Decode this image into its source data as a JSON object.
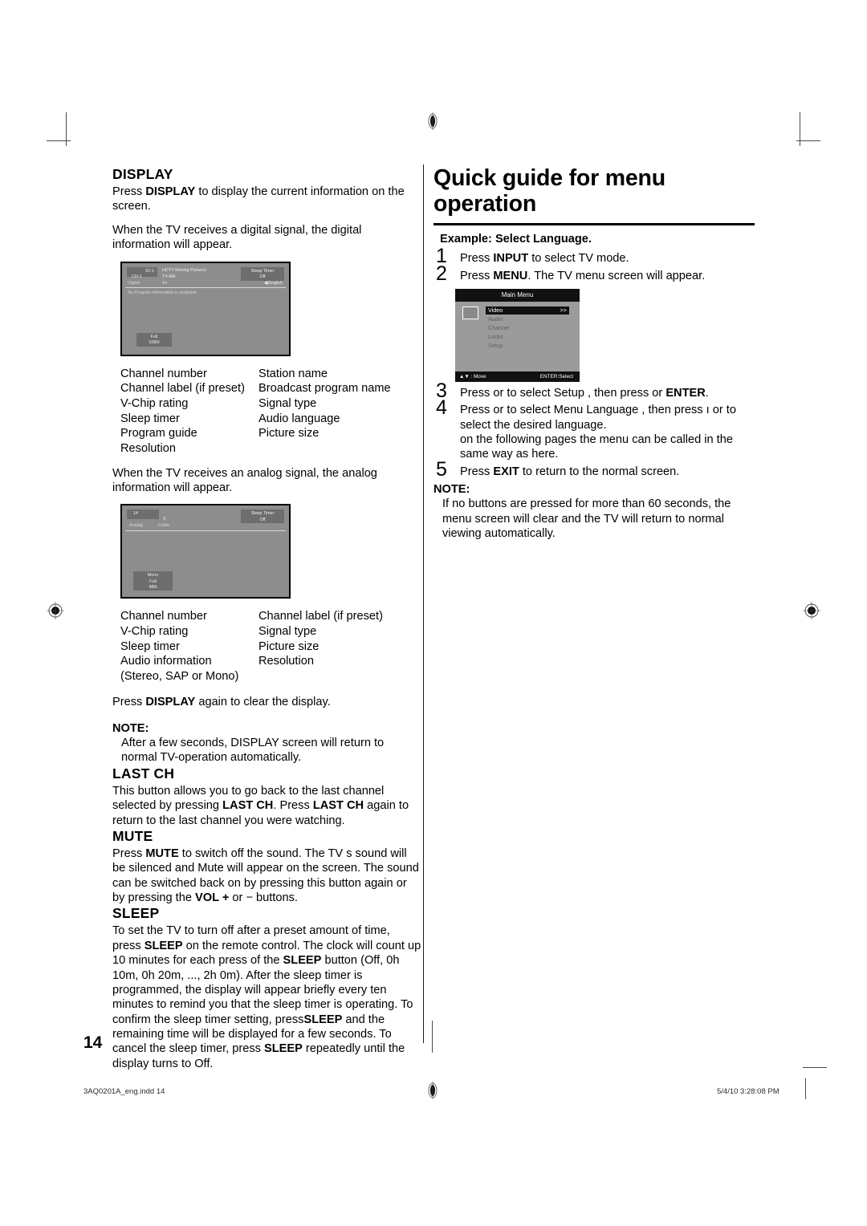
{
  "document": {
    "page_number": "14",
    "footer_filename": "3AQ0201A_eng.indd   14",
    "footer_timestamp": "5/4/10   3:28:08 PM"
  },
  "left_column": {
    "display": {
      "heading": "DISPLAY",
      "para1_a": "Press ",
      "para1_b": "DISPLAY",
      "para1_c": " to display the current information on the screen.",
      "para2": "When the TV receives a digital signal, the digital information will appear.",
      "para3": "When the TV receives an analog signal, the analog information will appear.",
      "digital_screen": {
        "channel_number": "62-1",
        "station_name": "HDTV Moving Picture1",
        "channel_label": "CH-1",
        "rating": "TV-MA",
        "signal_type": "Digital",
        "source": "Air",
        "sleep_timer_title": "Sleep Timer",
        "sleep_timer_value": "Off",
        "audio_language": "English",
        "program_info": "No Program Information is available",
        "picture_size": "Full",
        "resolution": "1080i"
      },
      "digital_legend": [
        [
          "Channel number",
          "Station name"
        ],
        [
          "Channel label (if preset)",
          "Broadcast program name"
        ],
        [
          "V-Chip rating",
          "Signal type"
        ],
        [
          "Sleep timer",
          "Audio language"
        ],
        [
          "Program guide",
          "Picture size"
        ],
        [
          "Resolution",
          ""
        ]
      ],
      "analog_screen": {
        "channel_number": "14",
        "channel_label": "X",
        "signal_type": "Analog",
        "source": "Cable",
        "sleep_timer_title": "Sleep Timer",
        "sleep_timer_value": "Off",
        "audio_information": "Mono",
        "picture_size": "Full",
        "resolution": "480i"
      },
      "analog_legend": [
        [
          "Channel number",
          "Channel label (if preset)"
        ],
        [
          "V-Chip rating",
          "Signal type"
        ],
        [
          "Sleep timer",
          "Picture size"
        ],
        [
          "Audio information",
          "Resolution"
        ],
        [
          "(Stereo, SAP or Mono)",
          ""
        ]
      ],
      "clear_a": "Press ",
      "clear_b": "DISPLAY",
      "clear_c": " again to clear the display.",
      "note_label": "NOTE:",
      "note_text": "After a few seconds, DISPLAY screen will return to normal TV-operation automatically."
    },
    "last_ch": {
      "heading": "LAST CH",
      "text_a": "This button allows you to go back to the last channel selected by pressing ",
      "text_b": "LAST CH",
      "text_c": ". Press ",
      "text_d": "LAST CH",
      "text_e": " again to return to the last channel you were watching."
    },
    "mute": {
      "heading": "MUTE",
      "text_a": "Press ",
      "text_b": "MUTE",
      "text_c": " to switch off the sound. The TV s sound will be silenced and  Mute  will appear on the screen. The sound can be switched back on by pressing this button again or by pressing the ",
      "text_d": "VOL +",
      "text_e": " or − buttons."
    },
    "sleep": {
      "heading": "SLEEP",
      "t1": "To set the TV to turn off after a preset amount of time, press ",
      "t2": "SLEEP",
      "t3": " on the remote control. The clock will count up 10 minutes for each press of the ",
      "t4": "SLEEP",
      "t5": " button (Off, 0h 10m, 0h 20m, ..., 2h 0m). After the sleep timer is programmed, the display will appear briefly every ten minutes to remind you that the sleep timer is operating. To confirm the sleep timer setting, press",
      "t6": "SLEEP",
      "t7": " and the remaining time will be displayed for a few seconds. To cancel the sleep timer, press ",
      "t8": "SLEEP",
      "t9": " repeatedly until the display turns to Off."
    }
  },
  "right_column": {
    "title": "Quick guide for menu operation",
    "example_label": "Example: Select Language.",
    "steps": [
      {
        "num": "1",
        "text_a": "Press ",
        "text_b": "INPUT",
        "text_c": " to select TV mode."
      },
      {
        "num": "2",
        "text_a": "Press ",
        "text_b": "MENU",
        "text_c": ". The TV menu screen will appear."
      },
      {
        "num": "3",
        "text_a": "Press    or    to select  Setup , then press    or ",
        "text_b": "ENTER",
        "text_c": "."
      },
      {
        "num": "4",
        "text_a": "Press    or    to select  Menu Language , then press ı  or to select the desired language.",
        "text_b": "",
        "text_c": ""
      },
      {
        "num": "5",
        "text_a": "Press ",
        "text_b": "EXIT",
        "text_c": " to return to the normal screen."
      }
    ],
    "step4_extra": " on the following pages the menu can be called in the same way as here.",
    "main_menu": {
      "title": "Main Menu",
      "items": [
        {
          "label": "Video",
          "arrows": ">>",
          "selected": true
        },
        {
          "label": "Audio",
          "arrows": "",
          "selected": false
        },
        {
          "label": "Channel",
          "arrows": "",
          "selected": false
        },
        {
          "label": "Locks",
          "arrows": "",
          "selected": false
        },
        {
          "label": "Setup",
          "arrows": "",
          "selected": false
        }
      ],
      "footer_left": "▲▼ : Move",
      "footer_right": "ENTER:Select"
    },
    "note_label": "NOTE:",
    "note_text": "If no buttons are pressed for more than 60 seconds, the menu screen will clear and the TV will return to normal viewing automatically."
  }
}
